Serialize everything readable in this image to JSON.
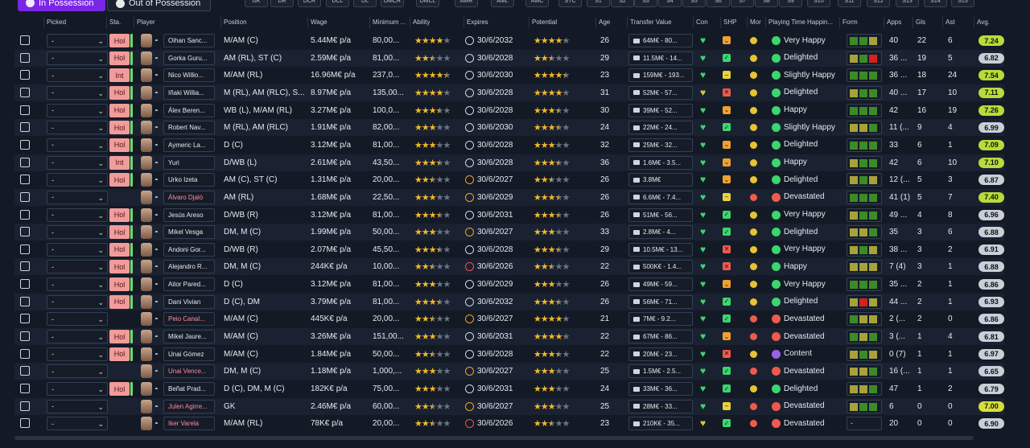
{
  "tabs": {
    "in_possession": "In Possession",
    "out_of_possession": "Out of Possession"
  },
  "positions": [
    "GK",
    "DR",
    "DCR",
    "DCL",
    "DL",
    "DMCR",
    "DMCL",
    "AMR",
    "AML",
    "AMC",
    "STC",
    "S1",
    "S2",
    "S3",
    "S4",
    "S5",
    "S6",
    "S7",
    "S8",
    "S9",
    "S10",
    "S11",
    "S12",
    "S13",
    "S14",
    "S15"
  ],
  "headers": {
    "picked": "Picked",
    "status": "Sta.",
    "player": "Player",
    "position": "Position",
    "wage": "Wage",
    "minimum": "Minimum ...",
    "ability": "Ability",
    "expires": "Expires",
    "potential": "Potential",
    "age": "Age",
    "transfer_value": "Transfer Value",
    "con": "Con",
    "shp": "SHP",
    "mor": "Mor",
    "playing_time": "Playing Time Happin...",
    "form": "Form",
    "apps": "Apps",
    "gls": "Gls",
    "ast": "Ast",
    "avg": "Avg."
  },
  "colors": {
    "accent": "#7a26e6",
    "status_bg": "#f29b9b",
    "fitness": "#6ddc6a",
    "star": "#f3b82c",
    "loan_name": "#ff8aa0",
    "form_green": "#3c8a28",
    "form_olive": "#a7a23a",
    "form_red": "#d82020"
  },
  "rows": [
    {
      "picked": "-",
      "status": "Hol",
      "name": "Oihan Sanc...",
      "loan": false,
      "position": "M/AM (C)",
      "wage": "5.44M€ p/a",
      "min": "80,00...",
      "ab": 4,
      "ab_half": false,
      "exp": "30/6/2032",
      "exp_state": "ok",
      "pot": 4,
      "pot_half": false,
      "age": "26",
      "tv": "64M€ - 80...",
      "con": "green",
      "shp": "orange",
      "mor": "amber",
      "pt": "Very Happy",
      "pt_c": "green",
      "form": [
        "g",
        "g",
        "o"
      ],
      "apps": "40",
      "gls": "22",
      "ast": "6",
      "avg": "7.24",
      "avg_c": "#b7dc3a"
    },
    {
      "picked": "-",
      "status": "Hol",
      "name": "Gorka Guru...",
      "loan": false,
      "position": "AM (RL), ST (C)",
      "wage": "2.59M€ p/a",
      "min": "81,00...",
      "ab": 2,
      "ab_half": true,
      "exp": "30/6/2028",
      "exp_state": "ok",
      "pot": 2,
      "pot_half": true,
      "age": "29",
      "tv": "11.5M€ - 14...",
      "con": "green",
      "shp": "green",
      "mor": "amber",
      "pt": "Delighted",
      "pt_c": "green",
      "form": [
        "o",
        "g",
        "r"
      ],
      "apps": "36 ...",
      "gls": "19",
      "ast": "5",
      "avg": "6.82",
      "avg_c": "#c9cfd8"
    },
    {
      "picked": "-",
      "status": "Int",
      "name": "Nico Willio...",
      "loan": false,
      "position": "M/AM (RL)",
      "wage": "16.96M€ p/a",
      "min": "237,0...",
      "ab": 4,
      "ab_half": true,
      "exp": "30/6/2030",
      "exp_state": "ok",
      "pot": 4,
      "pot_half": true,
      "age": "23",
      "tv": "159M€ - 193...",
      "con": "green",
      "shp": "yellow",
      "mor": "amber",
      "pt": "Slightly Happy",
      "pt_c": "green",
      "form": [
        "g",
        "g",
        "g"
      ],
      "apps": "36 ...",
      "gls": "18",
      "ast": "24",
      "avg": "7.54",
      "avg_c": "#b7dc3a"
    },
    {
      "picked": "-",
      "status": "Hol",
      "name": "Iñaki Willia...",
      "loan": false,
      "position": "M (RL), AM (RLC), S...",
      "wage": "8.97M€ p/a",
      "min": "135,00...",
      "ab": 4,
      "ab_half": false,
      "exp": "30/6/2028",
      "exp_state": "ok",
      "pot": 4,
      "pot_half": false,
      "age": "31",
      "tv": "52M€ - 57...",
      "con": "amber",
      "shp": "red",
      "mor": "amber",
      "pt": "Delighted",
      "pt_c": "green",
      "form": [
        "o",
        "g",
        "g"
      ],
      "apps": "40 ...",
      "gls": "17",
      "ast": "10",
      "avg": "7.11",
      "avg_c": "#b7dc3a"
    },
    {
      "picked": "-",
      "status": "Hol",
      "name": "Álex Beren...",
      "loan": false,
      "position": "WB (L), M/AM (RL)",
      "wage": "3.27M€ p/a",
      "min": "100,0...",
      "ab": 3,
      "ab_half": true,
      "exp": "30/6/2028",
      "exp_state": "ok",
      "pot": 3,
      "pot_half": true,
      "age": "30",
      "tv": "39M€ - 52...",
      "con": "green",
      "shp": "orange",
      "mor": "amber",
      "pt": "Happy",
      "pt_c": "green",
      "form": [
        "g",
        "g",
        "g"
      ],
      "apps": "42",
      "gls": "16",
      "ast": "19",
      "avg": "7.26",
      "avg_c": "#b7dc3a"
    },
    {
      "picked": "-",
      "status": "Hol",
      "name": "Robert Nav...",
      "loan": false,
      "position": "M (RL), AM (RLC)",
      "wage": "1.91M€ p/a",
      "min": "82,00...",
      "ab": 3,
      "ab_half": false,
      "exp": "30/6/2030",
      "exp_state": "ok",
      "pot": 3,
      "pot_half": true,
      "age": "24",
      "tv": "22M€ - 24...",
      "con": "green",
      "shp": "green",
      "mor": "amber",
      "pt": "Slightly Happy",
      "pt_c": "green",
      "form": [
        "o",
        "o",
        "g"
      ],
      "apps": "11 (...",
      "gls": "9",
      "ast": "4",
      "avg": "6.99",
      "avg_c": "#c9cfd8"
    },
    {
      "picked": "-",
      "status": "Hol",
      "name": "Aymeric La...",
      "loan": false,
      "position": "D (C)",
      "wage": "3.12M€ p/a",
      "min": "81,00...",
      "ab": 3,
      "ab_half": false,
      "exp": "30/6/2028",
      "exp_state": "ok",
      "pot": 3,
      "pot_half": false,
      "age": "32",
      "tv": "25M€ - 32...",
      "con": "green",
      "shp": "orange",
      "mor": "amber",
      "pt": "Delighted",
      "pt_c": "green",
      "form": [
        "g",
        "g",
        "g"
      ],
      "apps": "33",
      "gls": "6",
      "ast": "1",
      "avg": "7.09",
      "avg_c": "#b7dc3a"
    },
    {
      "picked": "-",
      "status": "Int",
      "name": "Yuri",
      "loan": false,
      "position": "D/WB (L)",
      "wage": "2.61M€ p/a",
      "min": "43,50...",
      "ab": 3,
      "ab_half": true,
      "exp": "30/6/2028",
      "exp_state": "ok",
      "pot": 3,
      "pot_half": true,
      "age": "36",
      "tv": "1.6M€ - 3.5...",
      "con": "green",
      "shp": "orange",
      "mor": "amber",
      "pt": "Happy",
      "pt_c": "green",
      "form": [
        "o",
        "g",
        "g"
      ],
      "apps": "42",
      "gls": "6",
      "ast": "10",
      "avg": "7.10",
      "avg_c": "#b7dc3a"
    },
    {
      "picked": "-",
      "status": "Hol",
      "name": "Urko Izeta",
      "loan": false,
      "position": "AM (C), ST (C)",
      "wage": "1.31M€ p/a",
      "min": "20,00...",
      "ab": 2,
      "ab_half": true,
      "exp": "30/6/2027",
      "exp_state": "warn",
      "pot": 2,
      "pot_half": true,
      "age": "26",
      "tv": "3.8M€",
      "con": "green",
      "shp": "orange",
      "mor": "amber",
      "pt": "Delighted",
      "pt_c": "green",
      "form": [
        "o",
        "g",
        "o"
      ],
      "apps": "12 (...",
      "gls": "5",
      "ast": "3",
      "avg": "6.87",
      "avg_c": "#c9cfd8"
    },
    {
      "picked": "-",
      "status": "",
      "name": "Álvaro Djaló",
      "loan": true,
      "position": "AM (RL)",
      "wage": "1.68M€ p/a",
      "min": "22,50...",
      "ab": 3,
      "ab_half": false,
      "exp": "30/6/2029",
      "exp_state": "warn",
      "pot": 3,
      "pot_half": true,
      "age": "26",
      "tv": "6.6M€ - 7.4...",
      "con": "green",
      "shp": "yellow",
      "mor": "red",
      "pt": "Devastated",
      "pt_c": "red",
      "form": [
        "g",
        "g",
        "g"
      ],
      "apps": "41 (1)",
      "gls": "5",
      "ast": "7",
      "avg": "7.40",
      "avg_c": "#b7dc3a"
    },
    {
      "picked": "-",
      "status": "Hol",
      "name": "Jesús Areso",
      "loan": false,
      "position": "D/WB (R)",
      "wage": "3.12M€ p/a",
      "min": "81,00...",
      "ab": 3,
      "ab_half": true,
      "exp": "30/6/2031",
      "exp_state": "ok",
      "pot": 3,
      "pot_half": true,
      "age": "26",
      "tv": "51M€ - 56...",
      "con": "green",
      "shp": "green",
      "mor": "amber",
      "pt": "Very Happy",
      "pt_c": "green",
      "form": [
        "o",
        "g",
        "g"
      ],
      "apps": "49 ...",
      "gls": "4",
      "ast": "8",
      "avg": "6.96",
      "avg_c": "#c9cfd8"
    },
    {
      "picked": "-",
      "status": "Hol",
      "name": "Mikel Vesga",
      "loan": false,
      "position": "DM, M (C)",
      "wage": "1.99M€ p/a",
      "min": "50,00...",
      "ab": 3,
      "ab_half": false,
      "exp": "30/6/2027",
      "exp_state": "warn",
      "pot": 3,
      "pot_half": false,
      "age": "33",
      "tv": "2.8M€ - 4...",
      "con": "green",
      "shp": "green",
      "mor": "amber",
      "pt": "Delighted",
      "pt_c": "green",
      "form": [
        "o",
        "o",
        "g"
      ],
      "apps": "35",
      "gls": "3",
      "ast": "6",
      "avg": "6.88",
      "avg_c": "#c9cfd8"
    },
    {
      "picked": "-",
      "status": "Hol",
      "name": "Andoni Gor...",
      "loan": false,
      "position": "D/WB (R)",
      "wage": "2.07M€ p/a",
      "min": "45,50...",
      "ab": 3,
      "ab_half": true,
      "exp": "30/6/2028",
      "exp_state": "ok",
      "pot": 3,
      "pot_half": true,
      "age": "29",
      "tv": "10.5M€ - 13...",
      "con": "green",
      "shp": "red",
      "mor": "amber",
      "pt": "Very Happy",
      "pt_c": "green",
      "form": [
        "o",
        "g",
        "o"
      ],
      "apps": "38 ...",
      "gls": "3",
      "ast": "2",
      "avg": "6.91",
      "avg_c": "#c9cfd8"
    },
    {
      "picked": "-",
      "status": "Hol",
      "name": "Alejandro R...",
      "loan": false,
      "position": "DM, M (C)",
      "wage": "244K€ p/a",
      "min": "10,00...",
      "ab": 2,
      "ab_half": true,
      "exp": "30/6/2026",
      "exp_state": "bad",
      "pot": 2,
      "pot_half": true,
      "age": "22",
      "tv": "500K€ - 1.4...",
      "con": "green",
      "shp": "red",
      "mor": "amber",
      "pt": "Happy",
      "pt_c": "green",
      "form": [
        "o",
        "o",
        "o"
      ],
      "apps": "7 (4)",
      "gls": "3",
      "ast": "1",
      "avg": "6.88",
      "avg_c": "#c9cfd8"
    },
    {
      "picked": "-",
      "status": "Hol",
      "name": "Aitor Pared...",
      "loan": false,
      "position": "D (C)",
      "wage": "3.12M€ p/a",
      "min": "81,00...",
      "ab": 3,
      "ab_half": false,
      "exp": "30/6/2029",
      "exp_state": "ok",
      "pot": 3,
      "pot_half": false,
      "age": "26",
      "tv": "49M€ - 59...",
      "con": "green",
      "shp": "orange",
      "mor": "amber",
      "pt": "Very Happy",
      "pt_c": "green",
      "form": [
        "g",
        "g",
        "g"
      ],
      "apps": "35 ...",
      "gls": "2",
      "ast": "1",
      "avg": "6.86",
      "avg_c": "#c9cfd8"
    },
    {
      "picked": "-",
      "status": "Hol",
      "name": "Dani Vivian",
      "loan": false,
      "position": "D (C), DM",
      "wage": "3.79M€ p/a",
      "min": "81,00...",
      "ab": 3,
      "ab_half": true,
      "exp": "30/6/2032",
      "exp_state": "ok",
      "pot": 3,
      "pot_half": true,
      "age": "26",
      "tv": "56M€ - 71...",
      "con": "green",
      "shp": "green",
      "mor": "amber",
      "pt": "Delighted",
      "pt_c": "green",
      "form": [
        "o",
        "r",
        "o"
      ],
      "apps": "44 ...",
      "gls": "2",
      "ast": "1",
      "avg": "6.93",
      "avg_c": "#c9cfd8"
    },
    {
      "picked": "-",
      "status": "",
      "name": "Peio Canal...",
      "loan": true,
      "position": "M/AM (C)",
      "wage": "445K€ p/a",
      "min": "20,00...",
      "ab": 2,
      "ab_half": true,
      "exp": "30/6/2027",
      "exp_state": "warn",
      "pot": 4,
      "pot_half": false,
      "age": "21",
      "tv": "7M€ - 9.2...",
      "con": "green",
      "shp": "green",
      "mor": "red",
      "pt": "Devastated",
      "pt_c": "red",
      "form": [
        "g",
        "o",
        "o"
      ],
      "apps": "2 (...",
      "gls": "2",
      "ast": "0",
      "avg": "6.86",
      "avg_c": "#c9cfd8"
    },
    {
      "picked": "-",
      "status": "Hol",
      "name": "Mikel Jaure...",
      "loan": false,
      "position": "M/AM (C)",
      "wage": "3.26M€ p/a",
      "min": "151,00...",
      "ab": 3,
      "ab_half": false,
      "exp": "30/6/2031",
      "exp_state": "ok",
      "pot": 4,
      "pot_half": false,
      "age": "22",
      "tv": "67M€ - 86...",
      "con": "green",
      "shp": "orange",
      "mor": "red",
      "pt": "Devastated",
      "pt_c": "red",
      "form": [
        "g",
        "o",
        "g"
      ],
      "apps": "3 (...",
      "gls": "1",
      "ast": "4",
      "avg": "6.81",
      "avg_c": "#c9cfd8"
    },
    {
      "picked": "-",
      "status": "Hol",
      "name": "Unai Gómez",
      "loan": false,
      "position": "M/AM (C)",
      "wage": "1.84M€ p/a",
      "min": "50,00...",
      "ab": 2,
      "ab_half": true,
      "exp": "30/6/2028",
      "exp_state": "ok",
      "pot": 3,
      "pot_half": true,
      "age": "22",
      "tv": "20M€ - 23...",
      "con": "green",
      "shp": "red",
      "mor": "amber",
      "pt": "Content",
      "pt_c": "purple",
      "form": [
        "o",
        "g",
        "o"
      ],
      "apps": "0 (7)",
      "gls": "1",
      "ast": "1",
      "avg": "6.97",
      "avg_c": "#c9cfd8"
    },
    {
      "picked": "-",
      "status": "",
      "name": "Unai Vence...",
      "loan": true,
      "position": "DM, M (C)",
      "wage": "1.18M€ p/a",
      "min": "1,000,...",
      "ab": 3,
      "ab_half": false,
      "exp": "30/6/2027",
      "exp_state": "warn",
      "pot": 3,
      "pot_half": false,
      "age": "25",
      "tv": "1.5M€ - 2.5...",
      "con": "green",
      "shp": "green",
      "mor": "red",
      "pt": "Devastated",
      "pt_c": "red",
      "form": [
        "o",
        "o",
        "g"
      ],
      "apps": "16 (...",
      "gls": "1",
      "ast": "1",
      "avg": "6.65",
      "avg_c": "#c9cfd8"
    },
    {
      "picked": "-",
      "status": "Hol",
      "name": "Beñat Prad...",
      "loan": false,
      "position": "D (C), DM, M (C)",
      "wage": "182K€ p/a",
      "min": "75,00...",
      "ab": 3,
      "ab_half": false,
      "exp": "30/6/2031",
      "exp_state": "ok",
      "pot": 3,
      "pot_half": false,
      "age": "24",
      "tv": "33M€ - 36...",
      "con": "green",
      "shp": "green",
      "mor": "amber",
      "pt": "Delighted",
      "pt_c": "green",
      "form": [
        "o",
        "o",
        "g"
      ],
      "apps": "47",
      "gls": "1",
      "ast": "2",
      "avg": "6.79",
      "avg_c": "#c9cfd8"
    },
    {
      "picked": "-",
      "status": "",
      "name": "Julen Agirre...",
      "loan": true,
      "position": "GK",
      "wage": "2.46M€ p/a",
      "min": "60,00...",
      "ab": 2,
      "ab_half": true,
      "exp": "30/6/2027",
      "exp_state": "warn",
      "pot": 3,
      "pot_half": false,
      "age": "25",
      "tv": "28M€ - 33...",
      "con": "green",
      "shp": "yellow",
      "mor": "red",
      "pt": "Devastated",
      "pt_c": "red",
      "form": [
        "o",
        "g",
        "g"
      ],
      "apps": "6",
      "gls": "0",
      "ast": "0",
      "avg": "7.00",
      "avg_c": "#d6df3a"
    },
    {
      "picked": "-",
      "status": "",
      "name": "Iker Varela",
      "loan": true,
      "position": "M/AM (RL)",
      "wage": "78K€ p/a",
      "min": "20,00...",
      "ab": 2,
      "ab_half": true,
      "exp": "30/6/2026",
      "exp_state": "bad",
      "pot": 2,
      "pot_half": true,
      "age": "23",
      "tv": "210K€ - 35...",
      "con": "amber",
      "shp": "green",
      "mor": "red",
      "pt": "Devastated",
      "pt_c": "red",
      "form": [],
      "form_text": "-",
      "apps": "20",
      "gls": "0",
      "ast": "0",
      "avg": "6.90",
      "avg_c": "#c9cfd8"
    }
  ]
}
